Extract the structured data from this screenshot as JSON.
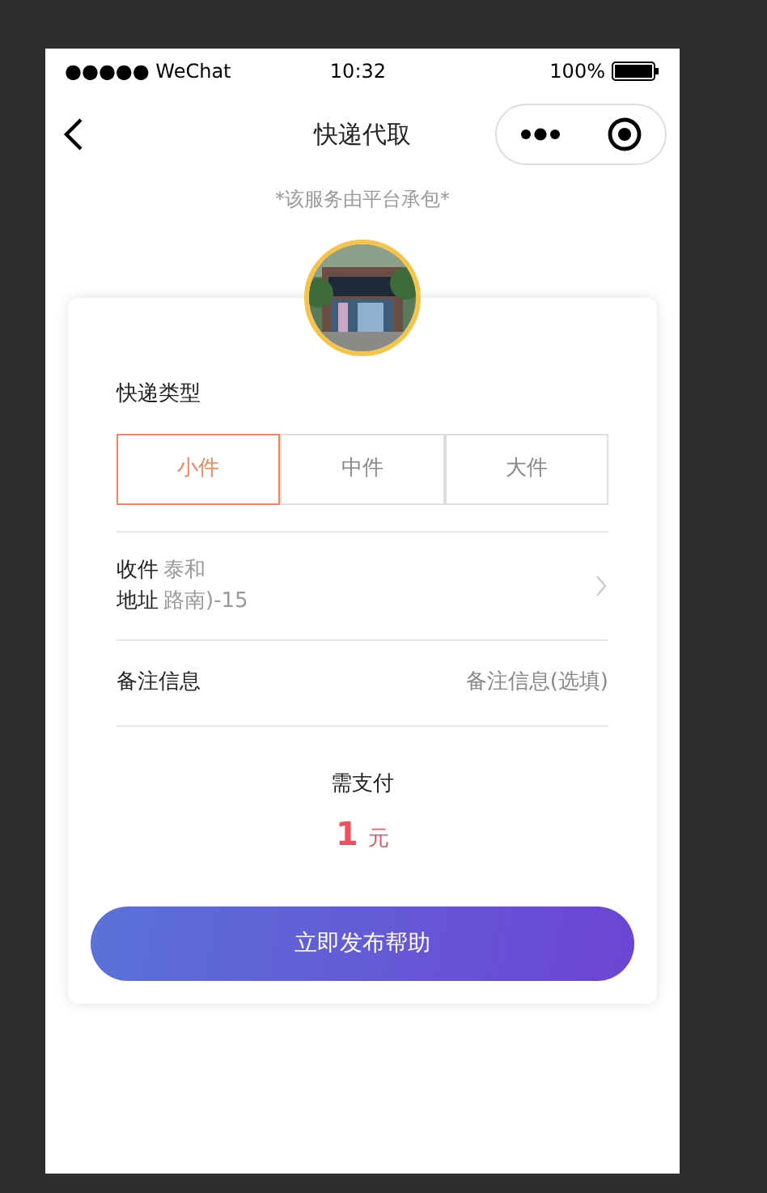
{
  "status_bar": {
    "carrier": "●●●●● WeChat",
    "time": "10:32",
    "battery": "100%"
  },
  "nav": {
    "title": "快递代取"
  },
  "notice": "*该服务由平台承包*",
  "package_type": {
    "label": "快递类型",
    "options": [
      {
        "label": "小件",
        "selected": true
      },
      {
        "label": "中件",
        "selected": false
      },
      {
        "label": "大件",
        "selected": false
      }
    ]
  },
  "address": {
    "label_lines": [
      "收件",
      "地址"
    ],
    "value_lines": [
      "泰和",
      "路南)-15"
    ]
  },
  "remark": {
    "label": "备注信息",
    "placeholder": "备注信息(选填)"
  },
  "payment": {
    "label": "需支付",
    "amount": "1",
    "unit": "元"
  },
  "submit": "立即发布帮助"
}
